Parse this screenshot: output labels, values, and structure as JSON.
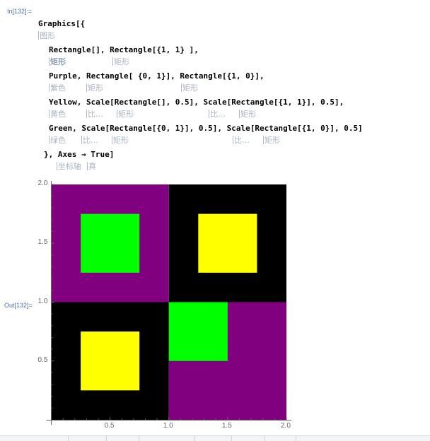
{
  "cell": {
    "in_label": "In[132]:=",
    "out_label": "Out[132]="
  },
  "code_lines": [
    {
      "text": "Graphics[{",
      "hints": [
        {
          "text": "图形"
        }
      ]
    },
    {
      "text": "Rectangle[], Rectangle[{1, 1} ],",
      "hints": [
        {
          "text": "矩形"
        },
        {
          "text": "矩形"
        }
      ]
    },
    {
      "text": "Purple, Rectangle[ {0, 1}], Rectangle[{1, 0}],",
      "hints": [
        {
          "text": "紫色"
        },
        {
          "text": "矩形"
        },
        {
          "text": "矩形"
        }
      ]
    },
    {
      "text": "Yellow, Scale[Rectangle[], 0.5], Scale[Rectangle[{1, 1}], 0.5],",
      "hints": [
        {
          "text": "黄色"
        },
        {
          "text": "比…"
        },
        {
          "text": "矩形"
        },
        {
          "text": "比…"
        },
        {
          "text": "矩形"
        }
      ]
    },
    {
      "text": "Green, Scale[Rectangle[{0, 1}], 0.5], Scale[Rectangle[{1, 0}], 0.5]",
      "hints": [
        {
          "text": "绿色"
        },
        {
          "text": "比…"
        },
        {
          "text": "矩形"
        },
        {
          "text": "比…"
        },
        {
          "text": "矩形"
        }
      ]
    },
    {
      "text": "}, Axes → True]",
      "hints": [
        {
          "text": "坐标轴"
        },
        {
          "text": "真"
        }
      ]
    }
  ],
  "colors": {
    "black": "#000000",
    "purple": "#800080",
    "yellow": "#ffff00",
    "green": "#00ff00",
    "axis": "#666666"
  },
  "chart_data": {
    "type": "graphics",
    "title": "",
    "axes": true,
    "xlim": [
      0,
      2
    ],
    "ylim": [
      0,
      2
    ],
    "x_ticks": [
      {
        "value": 0.5,
        "label": "0.5"
      },
      {
        "value": 1.0,
        "label": "1.0"
      },
      {
        "value": 1.5,
        "label": "1.5"
      },
      {
        "value": 2.0,
        "label": "2.0"
      }
    ],
    "y_ticks": [
      {
        "value": 0.5,
        "label": "0.5"
      },
      {
        "value": 1.0,
        "label": "1.0"
      },
      {
        "value": 1.5,
        "label": "1.5"
      },
      {
        "value": 2.0,
        "label": "2.0"
      }
    ],
    "minor_tick_step": 0.1,
    "rectangles": [
      {
        "name": "rect-0-0",
        "x0": 0,
        "y0": 0,
        "x1": 1,
        "y1": 1,
        "color": "black"
      },
      {
        "name": "rect-1-1",
        "x0": 1,
        "y0": 1,
        "x1": 2,
        "y1": 2,
        "color": "black"
      },
      {
        "name": "rect-0-1",
        "x0": 0,
        "y0": 1,
        "x1": 1,
        "y1": 2,
        "color": "purple"
      },
      {
        "name": "rect-1-0",
        "x0": 1,
        "y0": 0,
        "x1": 2,
        "y1": 1,
        "color": "purple"
      },
      {
        "name": "scaled-rect-0-0",
        "x0": 0.25,
        "y0": 0.25,
        "x1": 0.75,
        "y1": 0.75,
        "color": "yellow"
      },
      {
        "name": "scaled-rect-1-1",
        "x0": 1.25,
        "y0": 1.25,
        "x1": 1.75,
        "y1": 1.75,
        "color": "yellow"
      },
      {
        "name": "scaled-rect-0-1",
        "x0": 0.25,
        "y0": 1.25,
        "x1": 0.75,
        "y1": 1.75,
        "color": "green"
      },
      {
        "name": "scaled-rect-1-0",
        "x0": 1.0,
        "y0": 0.5,
        "x1": 1.5,
        "y1": 1.0,
        "color": "green"
      }
    ]
  }
}
